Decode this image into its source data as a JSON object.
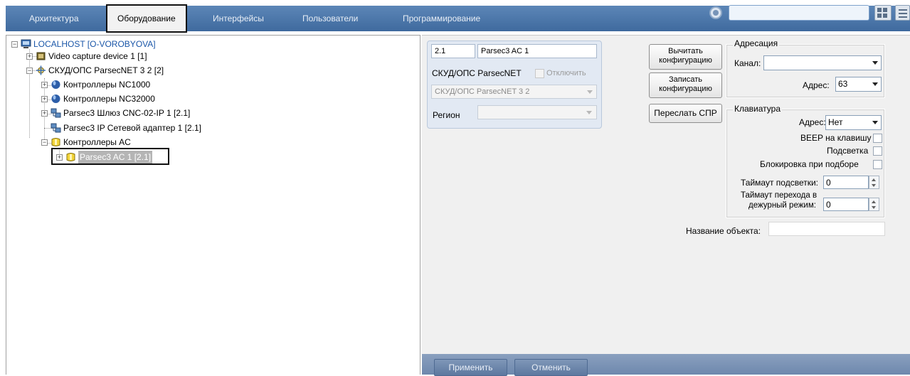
{
  "tabs": [
    {
      "label": "Архитектура",
      "active": false
    },
    {
      "label": "Оборудование",
      "active": true
    },
    {
      "label": "Интерфейсы",
      "active": false
    },
    {
      "label": "Пользователи",
      "active": false
    },
    {
      "label": "Программирование",
      "active": false
    }
  ],
  "search": {
    "value": ""
  },
  "tree": {
    "items": [
      {
        "label": "LOCALHOST [O-VOROBYOVA]",
        "icon": "computer-icon",
        "expanded": true,
        "color": "#1a56a8"
      },
      {
        "label": "Video capture device 1 [1]",
        "icon": "video-capture-icon",
        "expanded": false
      },
      {
        "label": "СКУД/ОПС ParsecNET 3 2 [2]",
        "icon": "parsec-net-icon",
        "expanded": true
      },
      {
        "label": "Контроллеры NC1000",
        "icon": "controller-group-icon",
        "expanded": false
      },
      {
        "label": "Контроллеры NC32000",
        "icon": "controller-group-icon",
        "expanded": false
      },
      {
        "label": "Parsec3 Шлюз CNC-02-IP 1 [2.1]",
        "icon": "network-gateway-icon",
        "expanded": false
      },
      {
        "label": "Parsec3 IP Сетевой адаптер 1 [2.1]",
        "icon": "network-adapter-icon",
        "expanded": false
      },
      {
        "label": "Контроллеры AC",
        "icon": "ac-controller-group-icon",
        "expanded": true
      },
      {
        "label": "Parsec3 AC 1 [2.1]",
        "icon": "ac-controller-icon",
        "expanded": false,
        "selected": true
      }
    ]
  },
  "card": {
    "id_value": "2.1",
    "name_value": "Parsec3 AC 1",
    "parent_label": "СКУД/ОПС ParsecNET",
    "disable_label": "Отключить",
    "parent_select": "СКУД/ОПС ParsecNET 3 2",
    "region_label": "Регион",
    "region_value": ""
  },
  "actions": {
    "read_config": "Вычитать конфигурацию",
    "write_config": "Записать конфигурацию",
    "send_spr": "Переслать СПР"
  },
  "addressing": {
    "title": "Адресация",
    "channel_label": "Канал:",
    "channel_value": "",
    "address_label": "Адрес:",
    "address_value": "63"
  },
  "keyboard": {
    "title": "Клавиатура",
    "address_label": "Адрес:",
    "address_value": "Нет",
    "beep_label": "BEEP на клавишу",
    "backlight_label": "Подсветка",
    "lock_label": "Блокировка при подборе",
    "backlight_timeout_label": "Таймаут подсветки:",
    "backlight_timeout_value": "0",
    "duty_timeout_label_1": "Таймаут перехода в",
    "duty_timeout_label_2": "дежурный режим:",
    "duty_timeout_value": "0"
  },
  "object_name": {
    "label": "Название объекта:",
    "value": ""
  },
  "footer": {
    "apply": "Применить",
    "cancel": "Отменить"
  }
}
